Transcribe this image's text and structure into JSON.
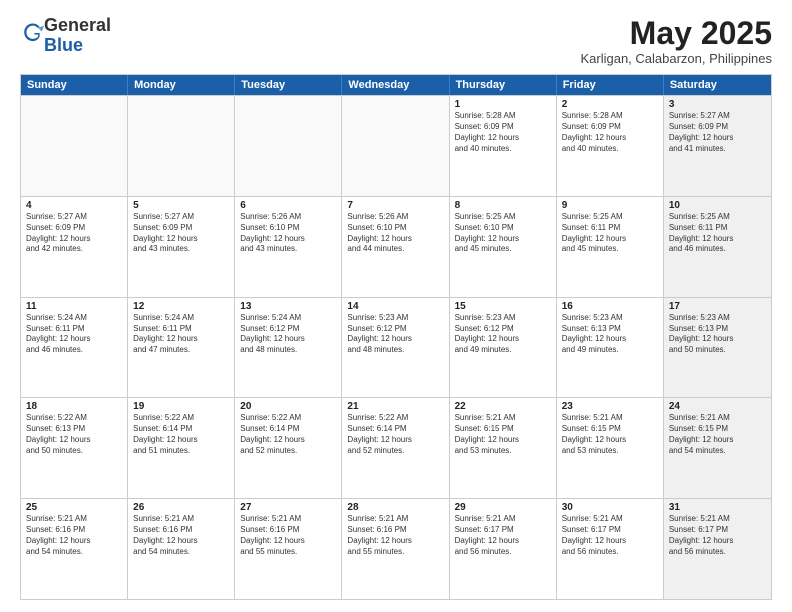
{
  "header": {
    "logo_general": "General",
    "logo_blue": "Blue",
    "month_title": "May 2025",
    "location": "Karligan, Calabarzon, Philippines"
  },
  "days_of_week": [
    "Sunday",
    "Monday",
    "Tuesday",
    "Wednesday",
    "Thursday",
    "Friday",
    "Saturday"
  ],
  "rows": [
    [
      {
        "day": "",
        "info": "",
        "empty": true
      },
      {
        "day": "",
        "info": "",
        "empty": true
      },
      {
        "day": "",
        "info": "",
        "empty": true
      },
      {
        "day": "",
        "info": "",
        "empty": true
      },
      {
        "day": "1",
        "info": "Sunrise: 5:28 AM\nSunset: 6:09 PM\nDaylight: 12 hours\nand 40 minutes."
      },
      {
        "day": "2",
        "info": "Sunrise: 5:28 AM\nSunset: 6:09 PM\nDaylight: 12 hours\nand 40 minutes."
      },
      {
        "day": "3",
        "info": "Sunrise: 5:27 AM\nSunset: 6:09 PM\nDaylight: 12 hours\nand 41 minutes.",
        "shaded": true
      }
    ],
    [
      {
        "day": "4",
        "info": "Sunrise: 5:27 AM\nSunset: 6:09 PM\nDaylight: 12 hours\nand 42 minutes."
      },
      {
        "day": "5",
        "info": "Sunrise: 5:27 AM\nSunset: 6:09 PM\nDaylight: 12 hours\nand 43 minutes."
      },
      {
        "day": "6",
        "info": "Sunrise: 5:26 AM\nSunset: 6:10 PM\nDaylight: 12 hours\nand 43 minutes."
      },
      {
        "day": "7",
        "info": "Sunrise: 5:26 AM\nSunset: 6:10 PM\nDaylight: 12 hours\nand 44 minutes."
      },
      {
        "day": "8",
        "info": "Sunrise: 5:25 AM\nSunset: 6:10 PM\nDaylight: 12 hours\nand 45 minutes."
      },
      {
        "day": "9",
        "info": "Sunrise: 5:25 AM\nSunset: 6:11 PM\nDaylight: 12 hours\nand 45 minutes."
      },
      {
        "day": "10",
        "info": "Sunrise: 5:25 AM\nSunset: 6:11 PM\nDaylight: 12 hours\nand 46 minutes.",
        "shaded": true
      }
    ],
    [
      {
        "day": "11",
        "info": "Sunrise: 5:24 AM\nSunset: 6:11 PM\nDaylight: 12 hours\nand 46 minutes."
      },
      {
        "day": "12",
        "info": "Sunrise: 5:24 AM\nSunset: 6:11 PM\nDaylight: 12 hours\nand 47 minutes."
      },
      {
        "day": "13",
        "info": "Sunrise: 5:24 AM\nSunset: 6:12 PM\nDaylight: 12 hours\nand 48 minutes."
      },
      {
        "day": "14",
        "info": "Sunrise: 5:23 AM\nSunset: 6:12 PM\nDaylight: 12 hours\nand 48 minutes."
      },
      {
        "day": "15",
        "info": "Sunrise: 5:23 AM\nSunset: 6:12 PM\nDaylight: 12 hours\nand 49 minutes."
      },
      {
        "day": "16",
        "info": "Sunrise: 5:23 AM\nSunset: 6:13 PM\nDaylight: 12 hours\nand 49 minutes."
      },
      {
        "day": "17",
        "info": "Sunrise: 5:23 AM\nSunset: 6:13 PM\nDaylight: 12 hours\nand 50 minutes.",
        "shaded": true
      }
    ],
    [
      {
        "day": "18",
        "info": "Sunrise: 5:22 AM\nSunset: 6:13 PM\nDaylight: 12 hours\nand 50 minutes."
      },
      {
        "day": "19",
        "info": "Sunrise: 5:22 AM\nSunset: 6:14 PM\nDaylight: 12 hours\nand 51 minutes."
      },
      {
        "day": "20",
        "info": "Sunrise: 5:22 AM\nSunset: 6:14 PM\nDaylight: 12 hours\nand 52 minutes."
      },
      {
        "day": "21",
        "info": "Sunrise: 5:22 AM\nSunset: 6:14 PM\nDaylight: 12 hours\nand 52 minutes."
      },
      {
        "day": "22",
        "info": "Sunrise: 5:21 AM\nSunset: 6:15 PM\nDaylight: 12 hours\nand 53 minutes."
      },
      {
        "day": "23",
        "info": "Sunrise: 5:21 AM\nSunset: 6:15 PM\nDaylight: 12 hours\nand 53 minutes."
      },
      {
        "day": "24",
        "info": "Sunrise: 5:21 AM\nSunset: 6:15 PM\nDaylight: 12 hours\nand 54 minutes.",
        "shaded": true
      }
    ],
    [
      {
        "day": "25",
        "info": "Sunrise: 5:21 AM\nSunset: 6:16 PM\nDaylight: 12 hours\nand 54 minutes."
      },
      {
        "day": "26",
        "info": "Sunrise: 5:21 AM\nSunset: 6:16 PM\nDaylight: 12 hours\nand 54 minutes."
      },
      {
        "day": "27",
        "info": "Sunrise: 5:21 AM\nSunset: 6:16 PM\nDaylight: 12 hours\nand 55 minutes."
      },
      {
        "day": "28",
        "info": "Sunrise: 5:21 AM\nSunset: 6:16 PM\nDaylight: 12 hours\nand 55 minutes."
      },
      {
        "day": "29",
        "info": "Sunrise: 5:21 AM\nSunset: 6:17 PM\nDaylight: 12 hours\nand 56 minutes."
      },
      {
        "day": "30",
        "info": "Sunrise: 5:21 AM\nSunset: 6:17 PM\nDaylight: 12 hours\nand 56 minutes."
      },
      {
        "day": "31",
        "info": "Sunrise: 5:21 AM\nSunset: 6:17 PM\nDaylight: 12 hours\nand 56 minutes.",
        "shaded": true
      }
    ]
  ]
}
